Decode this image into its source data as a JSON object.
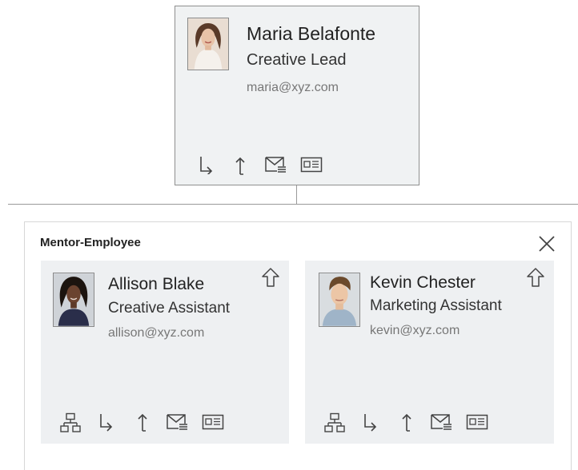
{
  "manager": {
    "name": "Maria Belafonte",
    "role": "Creative Lead",
    "email": "maria@xyz.com"
  },
  "panel": {
    "title": "Mentor-Employee"
  },
  "employees": [
    {
      "name": "Allison Blake",
      "role": "Creative Assistant",
      "email": "allison@xyz.com"
    },
    {
      "name": "Kevin Chester",
      "role": "Marketing Assistant",
      "email": "kevin@xyz.com"
    }
  ],
  "icons": {
    "subordinates": "org-chart-icon",
    "child": "arrow-down-right-icon",
    "parent": "arrow-up-icon",
    "email": "mail-icon",
    "details": "id-card-icon",
    "go_up": "up-arrow-outline-icon",
    "close": "close-icon"
  },
  "colors": {
    "card_background": "#eef0f2",
    "border": "#8f8f8f",
    "email_text": "#777777"
  }
}
